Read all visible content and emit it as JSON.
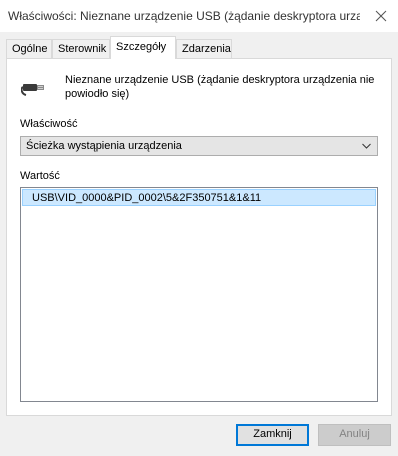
{
  "window": {
    "title": "Właściwości: Nieznane urządzenie USB (żądanie deskryptora urząd..."
  },
  "icons": {
    "close": "close-icon",
    "device": "usb-device-icon",
    "dropdown": "chevron-down-icon"
  },
  "tabs": [
    {
      "label": "Ogólne",
      "active": false
    },
    {
      "label": "Sterownik",
      "active": false
    },
    {
      "label": "Szczegóły",
      "active": true
    },
    {
      "label": "Zdarzenia",
      "active": false
    }
  ],
  "device": {
    "name": "Nieznane urządzenie USB (żądanie deskryptora urządzenia nie powiodło się)"
  },
  "property": {
    "label": "Właściwość",
    "selected": "Ścieżka wystąpienia urządzenia"
  },
  "value": {
    "label": "Wartość",
    "items": [
      "USB\\VID_0000&PID_0002\\5&2F350751&1&11"
    ]
  },
  "buttons": {
    "close": "Zamknij",
    "cancel": "Anuluj"
  },
  "colors": {
    "selection_bg": "#cce8ff",
    "selection_border": "#99d1ff",
    "accent": "#0078d7"
  }
}
